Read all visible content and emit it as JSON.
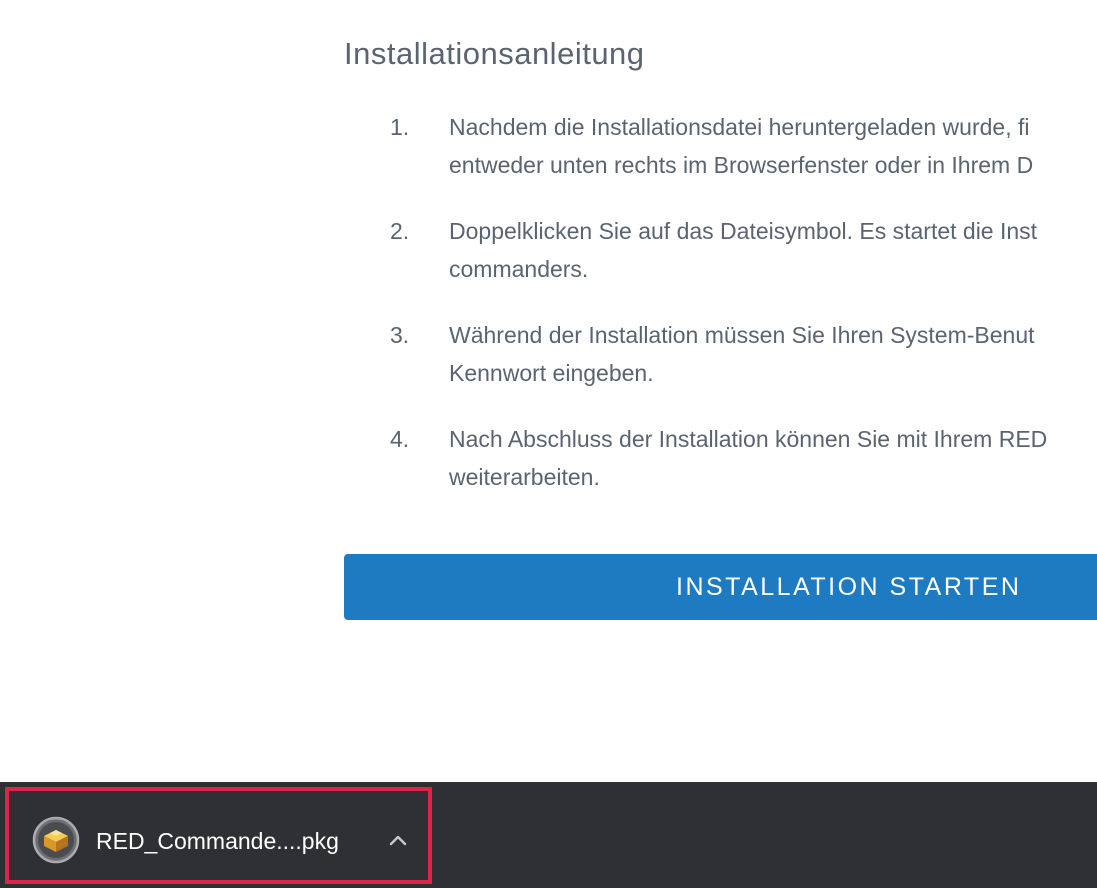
{
  "heading": "Installationsanleitung",
  "steps": [
    {
      "number": "1.",
      "text": "Nachdem die Installationsdatei heruntergeladen wurde, fi\nentweder unten rechts im Browserfenster oder in Ihrem D"
    },
    {
      "number": "2.",
      "text": "Doppelklicken Sie auf das Dateisymbol. Es startet die Inst\ncommanders."
    },
    {
      "number": "3.",
      "text": "Während der Installation müssen Sie Ihren System-Benut\nKennwort eingeben."
    },
    {
      "number": "4.",
      "text": "Nach Abschluss der Installation können Sie mit Ihrem RED\nweiterarbeiten."
    }
  ],
  "start_button": {
    "label": "INSTALLATION STARTEN"
  },
  "download_bar": {
    "filename": "RED_Commande....pkg",
    "file_icon": "package-installer-icon",
    "menu_icon": "chevron-up-icon",
    "highlight_color": "#e0234a"
  },
  "colors": {
    "button_blue": "#1f7bc1",
    "text_gray": "#5a6470",
    "download_bar_bg": "#2f3033"
  }
}
